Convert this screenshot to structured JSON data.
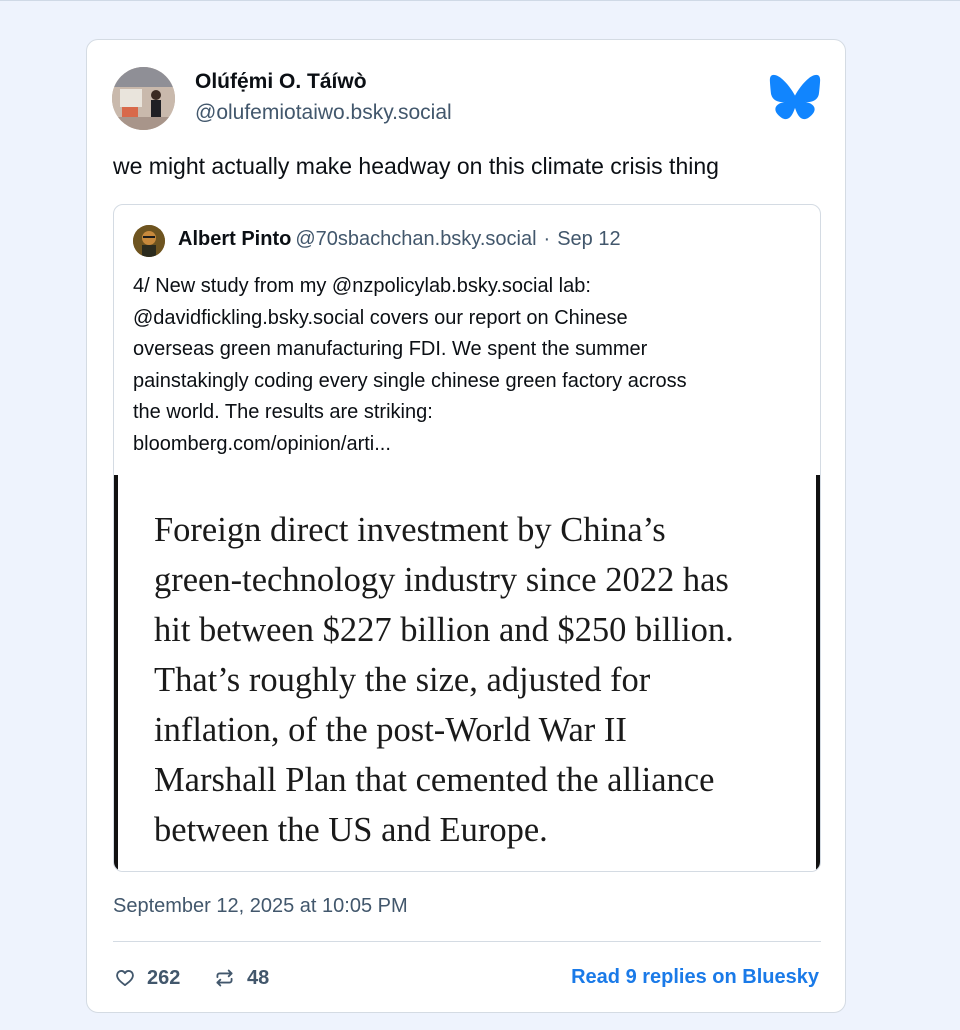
{
  "post": {
    "author_name": "Olúfẹ́mi O. Táíwò",
    "author_handle": "@olufemiotaiwo.bsky.social",
    "text": "we might actually make headway on this climate crisis thing",
    "timestamp": "September 12, 2025 at 10:05 PM",
    "likes": "262",
    "reposts": "48",
    "read_link": "Read 9 replies on Bluesky"
  },
  "quote": {
    "author_name": "Albert Pinto",
    "author_handle": "@70sbachchan.bsky.social",
    "separator": "·",
    "date": "Sep 12",
    "text": "4/ New study from my @nzpolicylab.bsky.social lab:\n@davidfickling.bsky.social  covers our report on Chinese\noverseas green manufacturing FDI. We spent the summer\npainstakingly coding every single chinese green factory across\nthe world. The results are striking:\nbloomberg.com/opinion/arti...",
    "image_text": "Foreign direct investment by China’s\ngreen-technology industry since 2022 has\nhit between $227 billion and $250 billion.\nThat’s roughly the size, adjusted for\ninflation, of the post-World War II\nMarshall Plan that cemented the alliance\nbetween the US and Europe."
  },
  "icons": {
    "brand": "bluesky-butterfly-icon",
    "like": "heart-icon",
    "repost": "repost-icon"
  },
  "colors": {
    "background": "#eef3fd",
    "accent": "#1a7ae8",
    "muted_text": "#42576c",
    "border": "#d4dbe3"
  }
}
